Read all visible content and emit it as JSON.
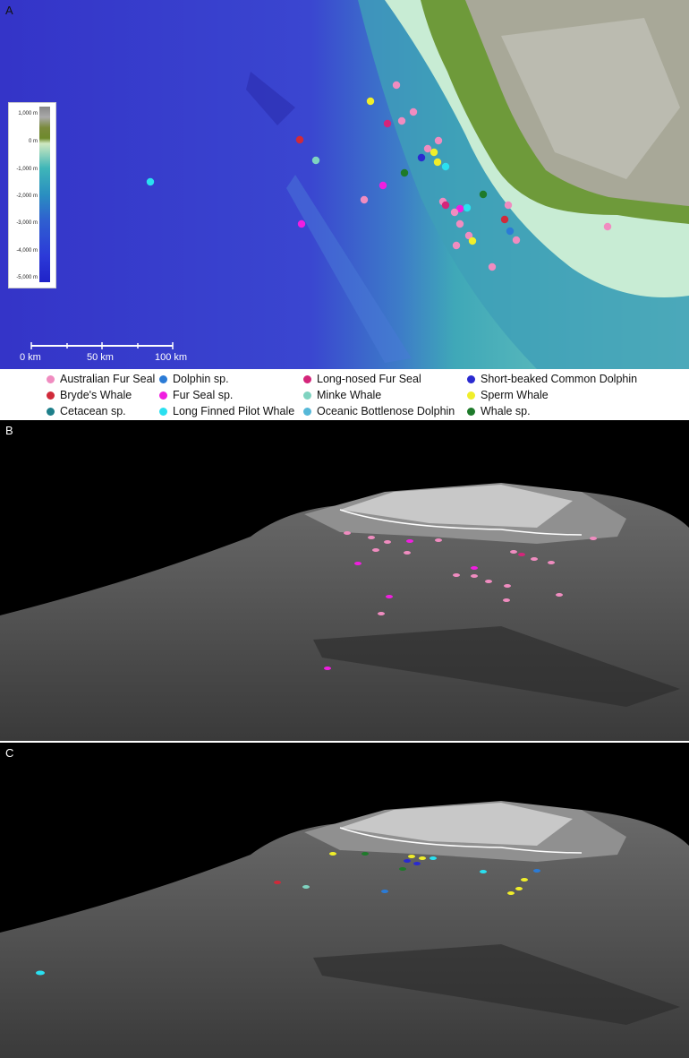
{
  "panels": {
    "a_label": "A",
    "b_label": "B",
    "c_label": "C"
  },
  "colorbar": {
    "ticks": [
      "1,000 m",
      "0 m",
      "-1,000 m",
      "-2,000 m",
      "-3,000 m",
      "-4,000 m",
      "-5,000 m"
    ]
  },
  "scalebar": {
    "labels": [
      "0 km",
      "50 km",
      "100 km"
    ]
  },
  "legend": [
    {
      "label": "Australian Fur Seal",
      "color": "#f08cc0"
    },
    {
      "label": "Dolphin sp.",
      "color": "#2b7bd6"
    },
    {
      "label": "Long-nosed Fur Seal",
      "color": "#d4257a"
    },
    {
      "label": "Short-beaked Common Dolphin",
      "color": "#2a2ad0"
    },
    {
      "label": "Bryde's Whale",
      "color": "#d02a3a"
    },
    {
      "label": "Fur Seal sp.",
      "color": "#f01ee0"
    },
    {
      "label": "Minke Whale",
      "color": "#7fd3c0"
    },
    {
      "label": "Sperm Whale",
      "color": "#f0ee2a"
    },
    {
      "label": "Cetacean sp.",
      "color": "#1e7f8a"
    },
    {
      "label": "Long Finned Pilot Whale",
      "color": "#2ae0f0"
    },
    {
      "label": "Oceanic Bottlenose Dolphin",
      "color": "#56b8d8"
    },
    {
      "label": "Whale sp.",
      "color": "#1e7a2a"
    }
  ]
}
